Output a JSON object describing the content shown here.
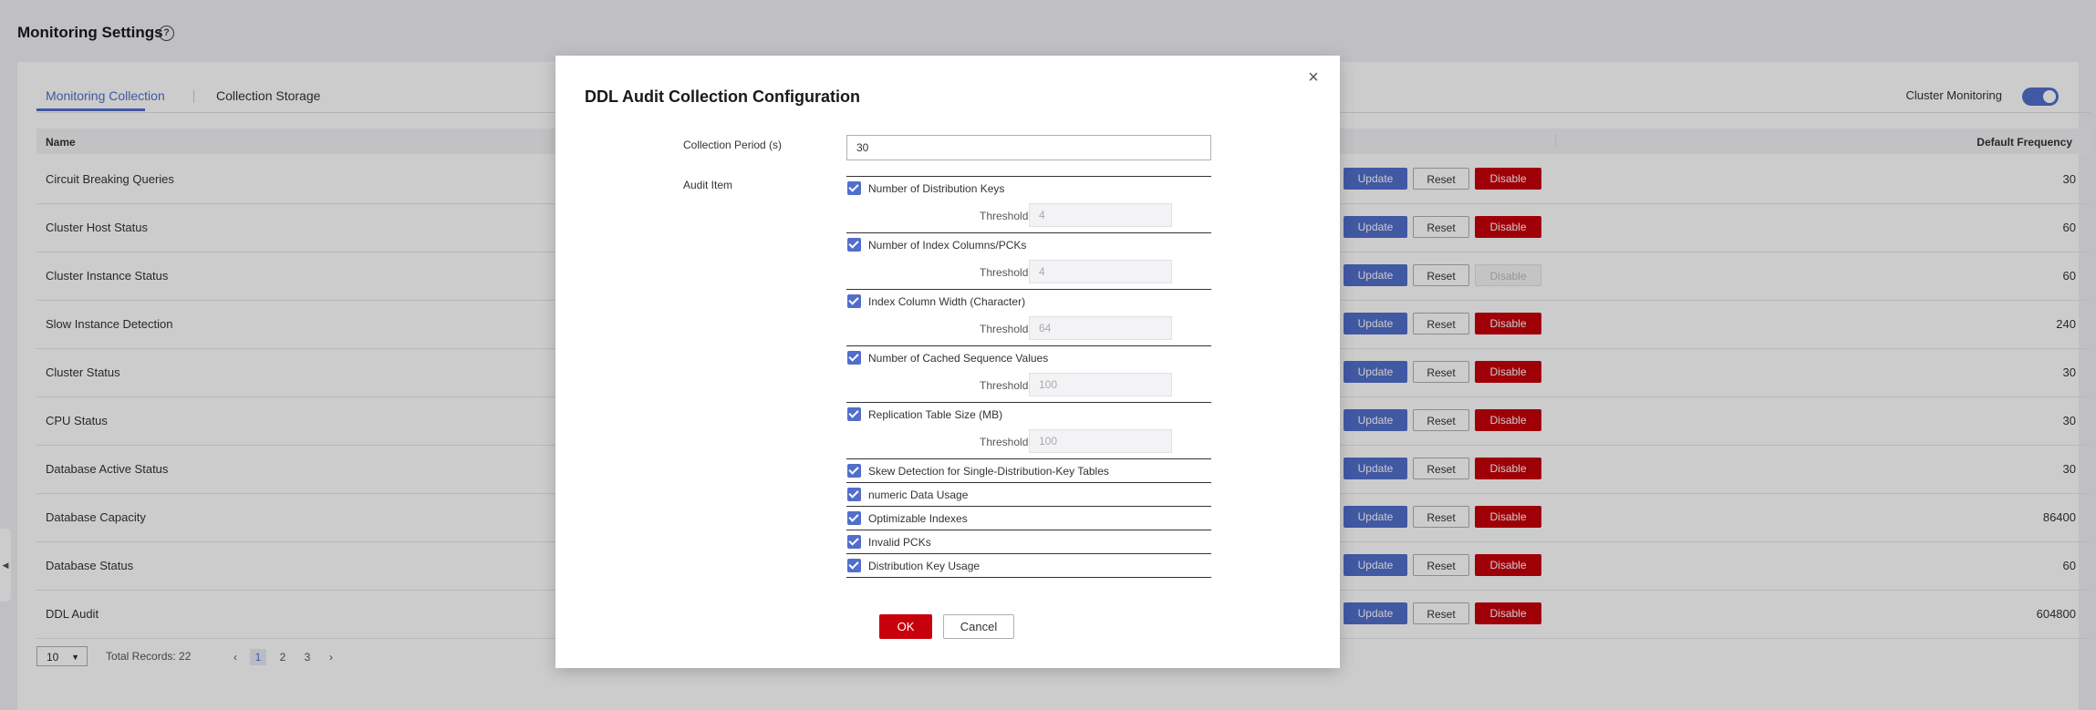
{
  "page": {
    "title": "Monitoring Settings"
  },
  "tabs": [
    {
      "label": "Monitoring Collection"
    },
    {
      "label": "Collection Storage"
    }
  ],
  "cluster_monitoring": {
    "label": "Cluster Monitoring",
    "enabled": true
  },
  "table": {
    "columns": {
      "name": "Name",
      "default_frequency": "Default Frequency"
    },
    "button_labels": {
      "update": "Update",
      "reset": "Reset",
      "disable": "Disable"
    },
    "rows": [
      {
        "name": "Circuit Breaking Queries",
        "frequency": "30",
        "disable_enabled": true
      },
      {
        "name": "Cluster Host Status",
        "frequency": "60",
        "disable_enabled": true
      },
      {
        "name": "Cluster Instance Status",
        "frequency": "60",
        "disable_enabled": false
      },
      {
        "name": "Slow Instance Detection",
        "frequency": "240",
        "disable_enabled": true
      },
      {
        "name": "Cluster Status",
        "frequency": "30",
        "disable_enabled": true
      },
      {
        "name": "CPU Status",
        "frequency": "30",
        "disable_enabled": true
      },
      {
        "name": "Database Active Status",
        "frequency": "30",
        "disable_enabled": true
      },
      {
        "name": "Database Capacity",
        "frequency": "86400",
        "disable_enabled": true
      },
      {
        "name": "Database Status",
        "frequency": "60",
        "disable_enabled": true
      },
      {
        "name": "DDL Audit",
        "frequency": "604800",
        "disable_enabled": true
      }
    ]
  },
  "pagination": {
    "page_size": "10",
    "total": "Total Records: 22",
    "pages": [
      "1",
      "2",
      "3"
    ],
    "current": "1"
  },
  "modal": {
    "title": "DDL Audit Collection Configuration",
    "close_icon": "close-icon",
    "collection_period_label": "Collection Period (s)",
    "collection_period_value": "30",
    "audit_item_label": "Audit Item",
    "threshold_label": "Threshold:",
    "items": [
      {
        "label": "Number of Distribution Keys",
        "checked": true,
        "threshold": "4"
      },
      {
        "label": "Number of Index Columns/PCKs",
        "checked": true,
        "threshold": "4"
      },
      {
        "label": "Index Column Width (Character)",
        "checked": true,
        "threshold": "64"
      },
      {
        "label": "Number of Cached Sequence Values",
        "checked": true,
        "threshold": "100"
      },
      {
        "label": "Replication Table Size (MB)",
        "checked": true,
        "threshold": "100"
      },
      {
        "label": "Skew Detection for Single-Distribution-Key Tables",
        "checked": true
      },
      {
        "label": "numeric Data Usage",
        "checked": true
      },
      {
        "label": "Optimizable Indexes",
        "checked": true
      },
      {
        "label": "Invalid PCKs",
        "checked": true
      },
      {
        "label": "Distribution Key Usage",
        "checked": true
      }
    ],
    "ok_label": "OK",
    "cancel_label": "Cancel"
  }
}
